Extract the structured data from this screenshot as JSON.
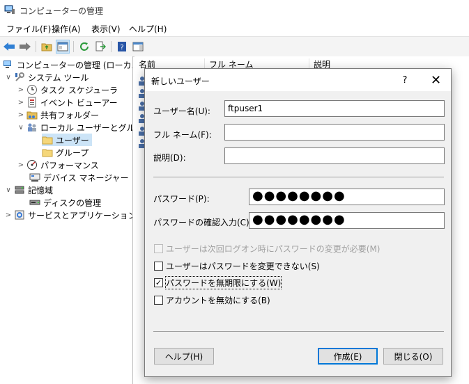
{
  "window": {
    "title": "コンピューターの管理"
  },
  "menu": [
    "ファイル(F)",
    "操作(A)",
    "表示(V)",
    "ヘルプ(H)"
  ],
  "tree": {
    "root": "コンピューターの管理 (ローカル)",
    "system_tools": "システム ツール",
    "task_scheduler": "タスク スケジューラ",
    "event_viewer": "イベント ビューアー",
    "shared_folders": "共有フォルダー",
    "local_users_groups": "ローカル ユーザーとグループ",
    "users": "ユーザー",
    "groups": "グループ",
    "performance": "パフォーマンス",
    "device_manager": "デバイス マネージャー",
    "storage": "記憶域",
    "disk_management": "ディスクの管理",
    "services_apps": "サービスとアプリケーション"
  },
  "list": {
    "columns": [
      "名前",
      "フル ネーム",
      "説明"
    ]
  },
  "dialog": {
    "title": "新しいユーザー",
    "help_glyph": "?",
    "close_glyph": "✕",
    "username_label": "ユーザー名(U):",
    "username_value": "ftpuser1",
    "fullname_label": "フル ネーム(F):",
    "fullname_value": "",
    "description_label": "説明(D):",
    "description_value": "",
    "password_label": "パスワード(P):",
    "password_value": "●●●●●●●●",
    "confirm_label": "パスワードの確認入力(C):",
    "confirm_value": "●●●●●●●●",
    "options": [
      {
        "label": "ユーザーは次回ログオン時にパスワードの変更が必要(M)",
        "checked": false,
        "disabled": true
      },
      {
        "label": "ユーザーはパスワードを変更できない(S)",
        "checked": false,
        "disabled": false
      },
      {
        "label": "パスワードを無期限にする(W)",
        "checked": true,
        "disabled": false
      },
      {
        "label": "アカウントを無効にする(B)",
        "checked": false,
        "disabled": false
      }
    ],
    "check_glyph": "✓",
    "buttons": {
      "help": "ヘルプ(H)",
      "create": "作成(E)",
      "close": "閉じる(O)"
    }
  },
  "colors": {
    "accent": "#0078d7",
    "selection": "#cce4f7"
  }
}
